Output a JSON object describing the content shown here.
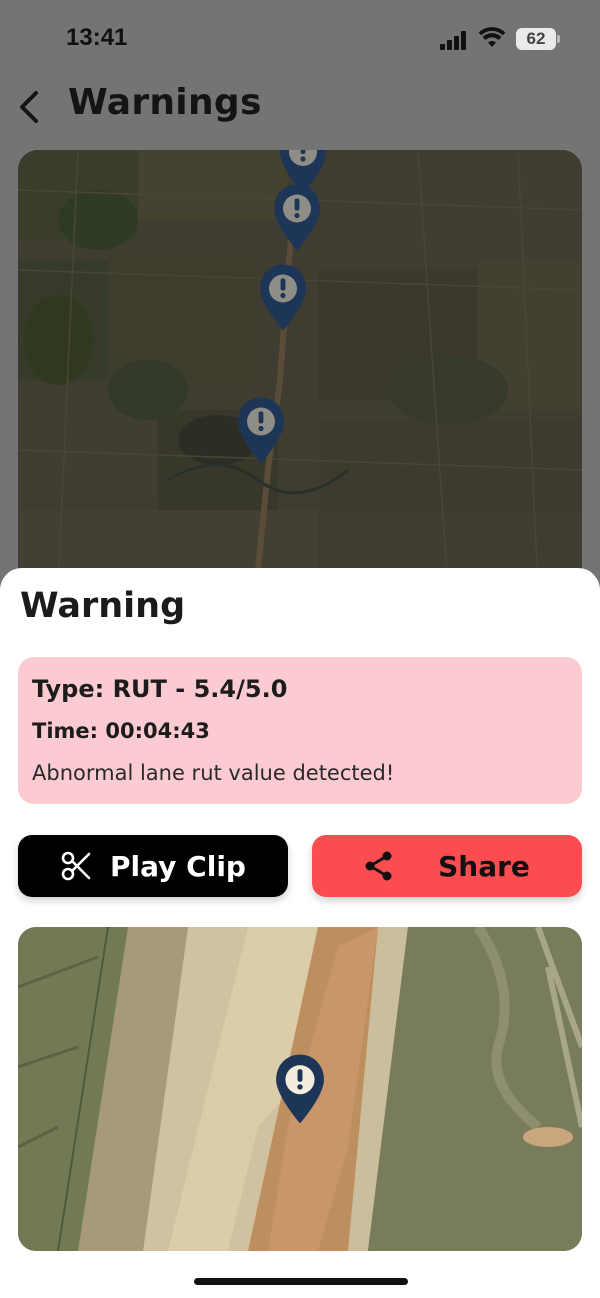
{
  "status_bar": {
    "time": "13:41",
    "battery": "62",
    "icons": [
      "signal-icon",
      "wifi-icon",
      "battery-icon"
    ]
  },
  "header": {
    "title": "Warnings",
    "back_icon": "chevron-left-icon"
  },
  "map_top": {
    "pin_count": 4,
    "pin_icon": "warning-pin-icon",
    "pin_color": "#1d3557"
  },
  "sheet": {
    "title": "Warning",
    "card": {
      "type": "Type: RUT - 5.4/5.0",
      "time": "Time: 00:04:43",
      "message": "Abnormal lane rut value detected!",
      "background": "#fccbd1"
    },
    "play_clip": {
      "label": "Play Clip",
      "icon": "scissors-icon"
    },
    "share": {
      "label": "Share",
      "icon": "share-icon",
      "color": "#fb4d50"
    },
    "map_bottom": {
      "pin_icon": "warning-pin-icon"
    }
  }
}
